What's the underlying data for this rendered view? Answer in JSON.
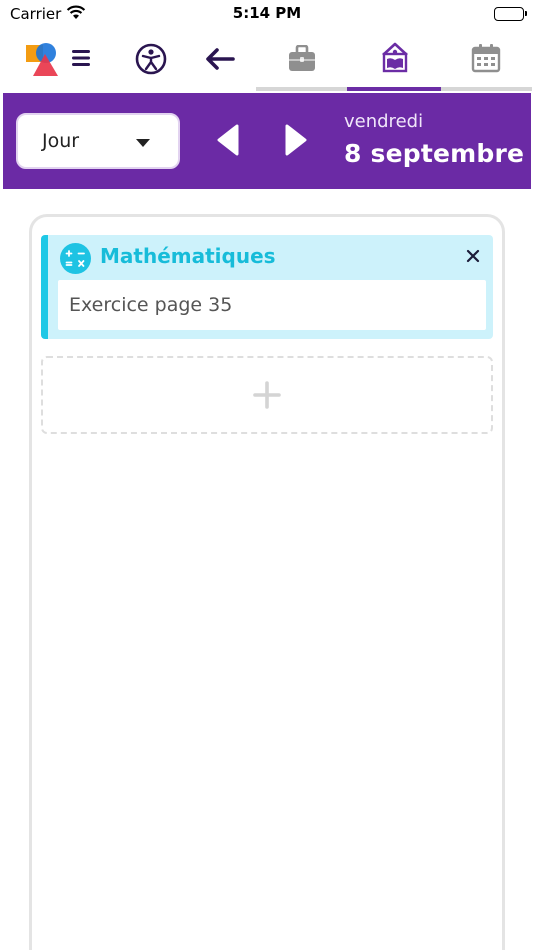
{
  "status_bar": {
    "carrier": "Carrier",
    "time": "5:14 PM",
    "battery_level": 1.0
  },
  "toolbar": {
    "icons": [
      "app-logo-icon",
      "menu-icon",
      "accessibility-icon",
      "back-arrow-icon",
      "briefcase-icon",
      "homework-book-icon",
      "calendar-icon"
    ],
    "active_tab": "homework-book-icon",
    "accent_color": "#6b2da5"
  },
  "header": {
    "view_mode": "Jour",
    "weekday": "vendredi",
    "date": "8 septembre",
    "background_color": "#6b2aa5"
  },
  "tasks": [
    {
      "subject": "Mathématiques",
      "subject_icon": "math-operators-icon",
      "description": "Exercice page 35",
      "color": "#1ec8e6"
    }
  ],
  "add_slot": {
    "icon": "plus-icon"
  }
}
